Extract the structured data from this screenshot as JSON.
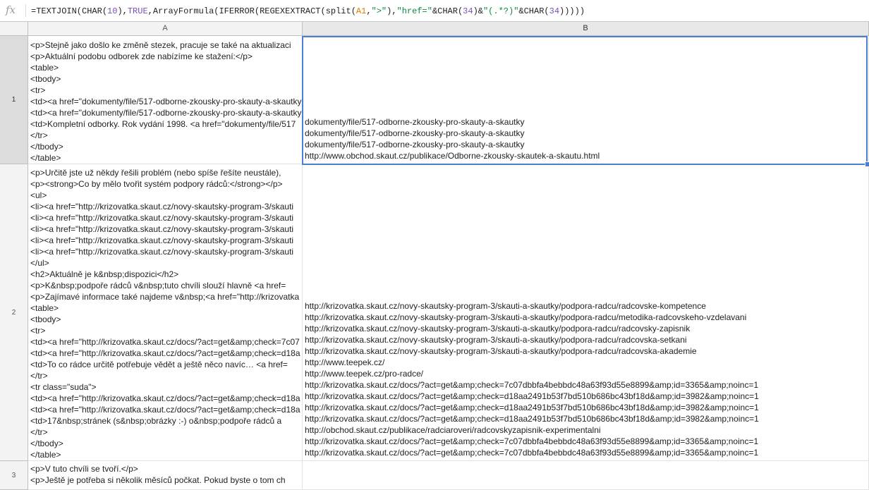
{
  "formula_bar": {
    "fx_label": "fx",
    "parts": [
      {
        "t": "=TEXTJOIN(CHAR(",
        "c": "plain"
      },
      {
        "t": "10",
        "c": "num"
      },
      {
        "t": "),",
        "c": "plain"
      },
      {
        "t": "TRUE",
        "c": "num"
      },
      {
        "t": ",ArrayFormula(IFERROR(REGEXEXTRACT(split(",
        "c": "plain"
      },
      {
        "t": "A1",
        "c": "ref"
      },
      {
        "t": ",",
        "c": "plain"
      },
      {
        "t": "\">\"",
        "c": "str"
      },
      {
        "t": "),",
        "c": "plain"
      },
      {
        "t": "\"href=\"",
        "c": "str"
      },
      {
        "t": "&CHAR(",
        "c": "plain"
      },
      {
        "t": "34",
        "c": "num"
      },
      {
        "t": ")&",
        "c": "plain"
      },
      {
        "t": "\"(.*?)\"",
        "c": "str"
      },
      {
        "t": "&CHAR(",
        "c": "plain"
      },
      {
        "t": "34",
        "c": "num"
      },
      {
        "t": ")))))",
        "c": "plain"
      }
    ]
  },
  "columns": [
    "A",
    "B"
  ],
  "rows": [
    {
      "label": "1",
      "a_lines": [
        "<p>Stejně jako došlo ke změně stezek, pracuje se také na aktualizaci",
        "<p>Aktuální podobu odborek zde nabízíme ke stažení:</p>",
        "<table>",
        "<tbody>",
        "<tr>",
        "<td><a href=\"dokumenty/file/517-odborne-zkousky-pro-skauty-a-skautky",
        "<td><a href=\"dokumenty/file/517-odborne-zkousky-pro-skauty-a-skautky",
        "<td>Kompletní odborky. Rok vydání 1998. <a href=\"dokumenty/file/517",
        "</tr>",
        "</tbody>",
        "</table>"
      ],
      "b_lines": [
        "dokumenty/file/517-odborne-zkousky-pro-skauty-a-skautky",
        "dokumenty/file/517-odborne-zkousky-pro-skauty-a-skautky",
        "dokumenty/file/517-odborne-zkousky-pro-skauty-a-skautky",
        "http://www.obchod.skaut.cz/publikace/Odborne-zkousky-skautek-a-skautu.html"
      ]
    },
    {
      "label": "2",
      "a_lines": [
        "<p>Určitě jste už někdy řešili problém (nebo spíše řešíte neustále),",
        "<p><strong>Co by mělo tvořit systém podpory rádců:</strong></p>",
        "<ul>",
        "<li><a href=\"http://krizovatka.skaut.cz/novy-skautsky-program-3/skauti",
        "<li><a href=\"http://krizovatka.skaut.cz/novy-skautsky-program-3/skauti",
        "<li><a href=\"http://krizovatka.skaut.cz/novy-skautsky-program-3/skauti",
        "<li><a href=\"http://krizovatka.skaut.cz/novy-skautsky-program-3/skauti",
        "<li><a href=\"http://krizovatka.skaut.cz/novy-skautsky-program-3/skauti",
        "</ul>",
        "<h2>Aktuálně je k&nbsp;dispozici</h2>",
        "<p>K&nbsp;podpoře rádců v&nbsp;tuto chvíli slouží hlavně <a href=",
        "<p>Zajímavé informace také najdeme v&nbsp;<a href=\"http://krizovatka",
        "<table>",
        "<tbody>",
        "<tr>",
        "<td><a href=\"http://krizovatka.skaut.cz/docs/?act=get&amp;check=7c07",
        "<td><a href=\"http://krizovatka.skaut.cz/docs/?act=get&amp;check=d18a",
        "<td>To co rádce určitě potřebuje vědět a ještě něco navíc… <a href=",
        "</tr>",
        "<tr class=\"suda\">",
        "<td><a href=\"http://krizovatka.skaut.cz/docs/?act=get&amp;check=d18a",
        "<td><a href=\"http://krizovatka.skaut.cz/docs/?act=get&amp;check=d18a",
        "<td>17&nbsp;stránek (s&nbsp;obrázky :-) o&nbsp;podpoře rádců a",
        "</tr>",
        "</tbody>",
        "</table>"
      ],
      "b_lines": [
        "http://krizovatka.skaut.cz/novy-skautsky-program-3/skauti-a-skautky/podpora-radcu/radcovske-kompetence",
        "http://krizovatka.skaut.cz/novy-skautsky-program-3/skauti-a-skautky/podpora-radcu/metodika-radcovskeho-vzdelavani",
        "http://krizovatka.skaut.cz/novy-skautsky-program-3/skauti-a-skautky/podpora-radcu/radcovsky-zapisnik",
        "http://krizovatka.skaut.cz/novy-skautsky-program-3/skauti-a-skautky/podpora-radcu/radcovska-setkani",
        "http://krizovatka.skaut.cz/novy-skautsky-program-3/skauti-a-skautky/podpora-radcu/radcovska-akademie",
        "http://www.teepek.cz/",
        "http://www.teepek.cz/pro-radce/",
        "http://krizovatka.skaut.cz/docs/?act=get&amp;check=7c07dbbfa4bebbdc48a63f93d55e8899&amp;id=3365&amp;noinc=1",
        "http://krizovatka.skaut.cz/docs/?act=get&amp;check=d18aa2491b53f7bd510b686bc43bf18d&amp;id=3982&amp;noinc=1",
        "http://krizovatka.skaut.cz/docs/?act=get&amp;check=d18aa2491b53f7bd510b686bc43bf18d&amp;id=3982&amp;noinc=1",
        "http://krizovatka.skaut.cz/docs/?act=get&amp;check=d18aa2491b53f7bd510b686bc43bf18d&amp;id=3982&amp;noinc=1",
        "http://obchod.skaut.cz/publikace/radciaroveri/radcovskyzapisnik-experimentalni",
        "http://krizovatka.skaut.cz/docs/?act=get&amp;check=7c07dbbfa4bebbdc48a63f93d55e8899&amp;id=3365&amp;noinc=1",
        "http://krizovatka.skaut.cz/docs/?act=get&amp;check=7c07dbbfa4bebbdc48a63f93d55e8899&amp;id=3365&amp;noinc=1"
      ]
    },
    {
      "label": "3",
      "a_lines": [
        "<p>V tuto chvíli se tvoří.</p>",
        "<p>Ještě je potřeba si několik měsíců počkat. Pokud byste o tom ch"
      ],
      "b_lines": []
    }
  ]
}
